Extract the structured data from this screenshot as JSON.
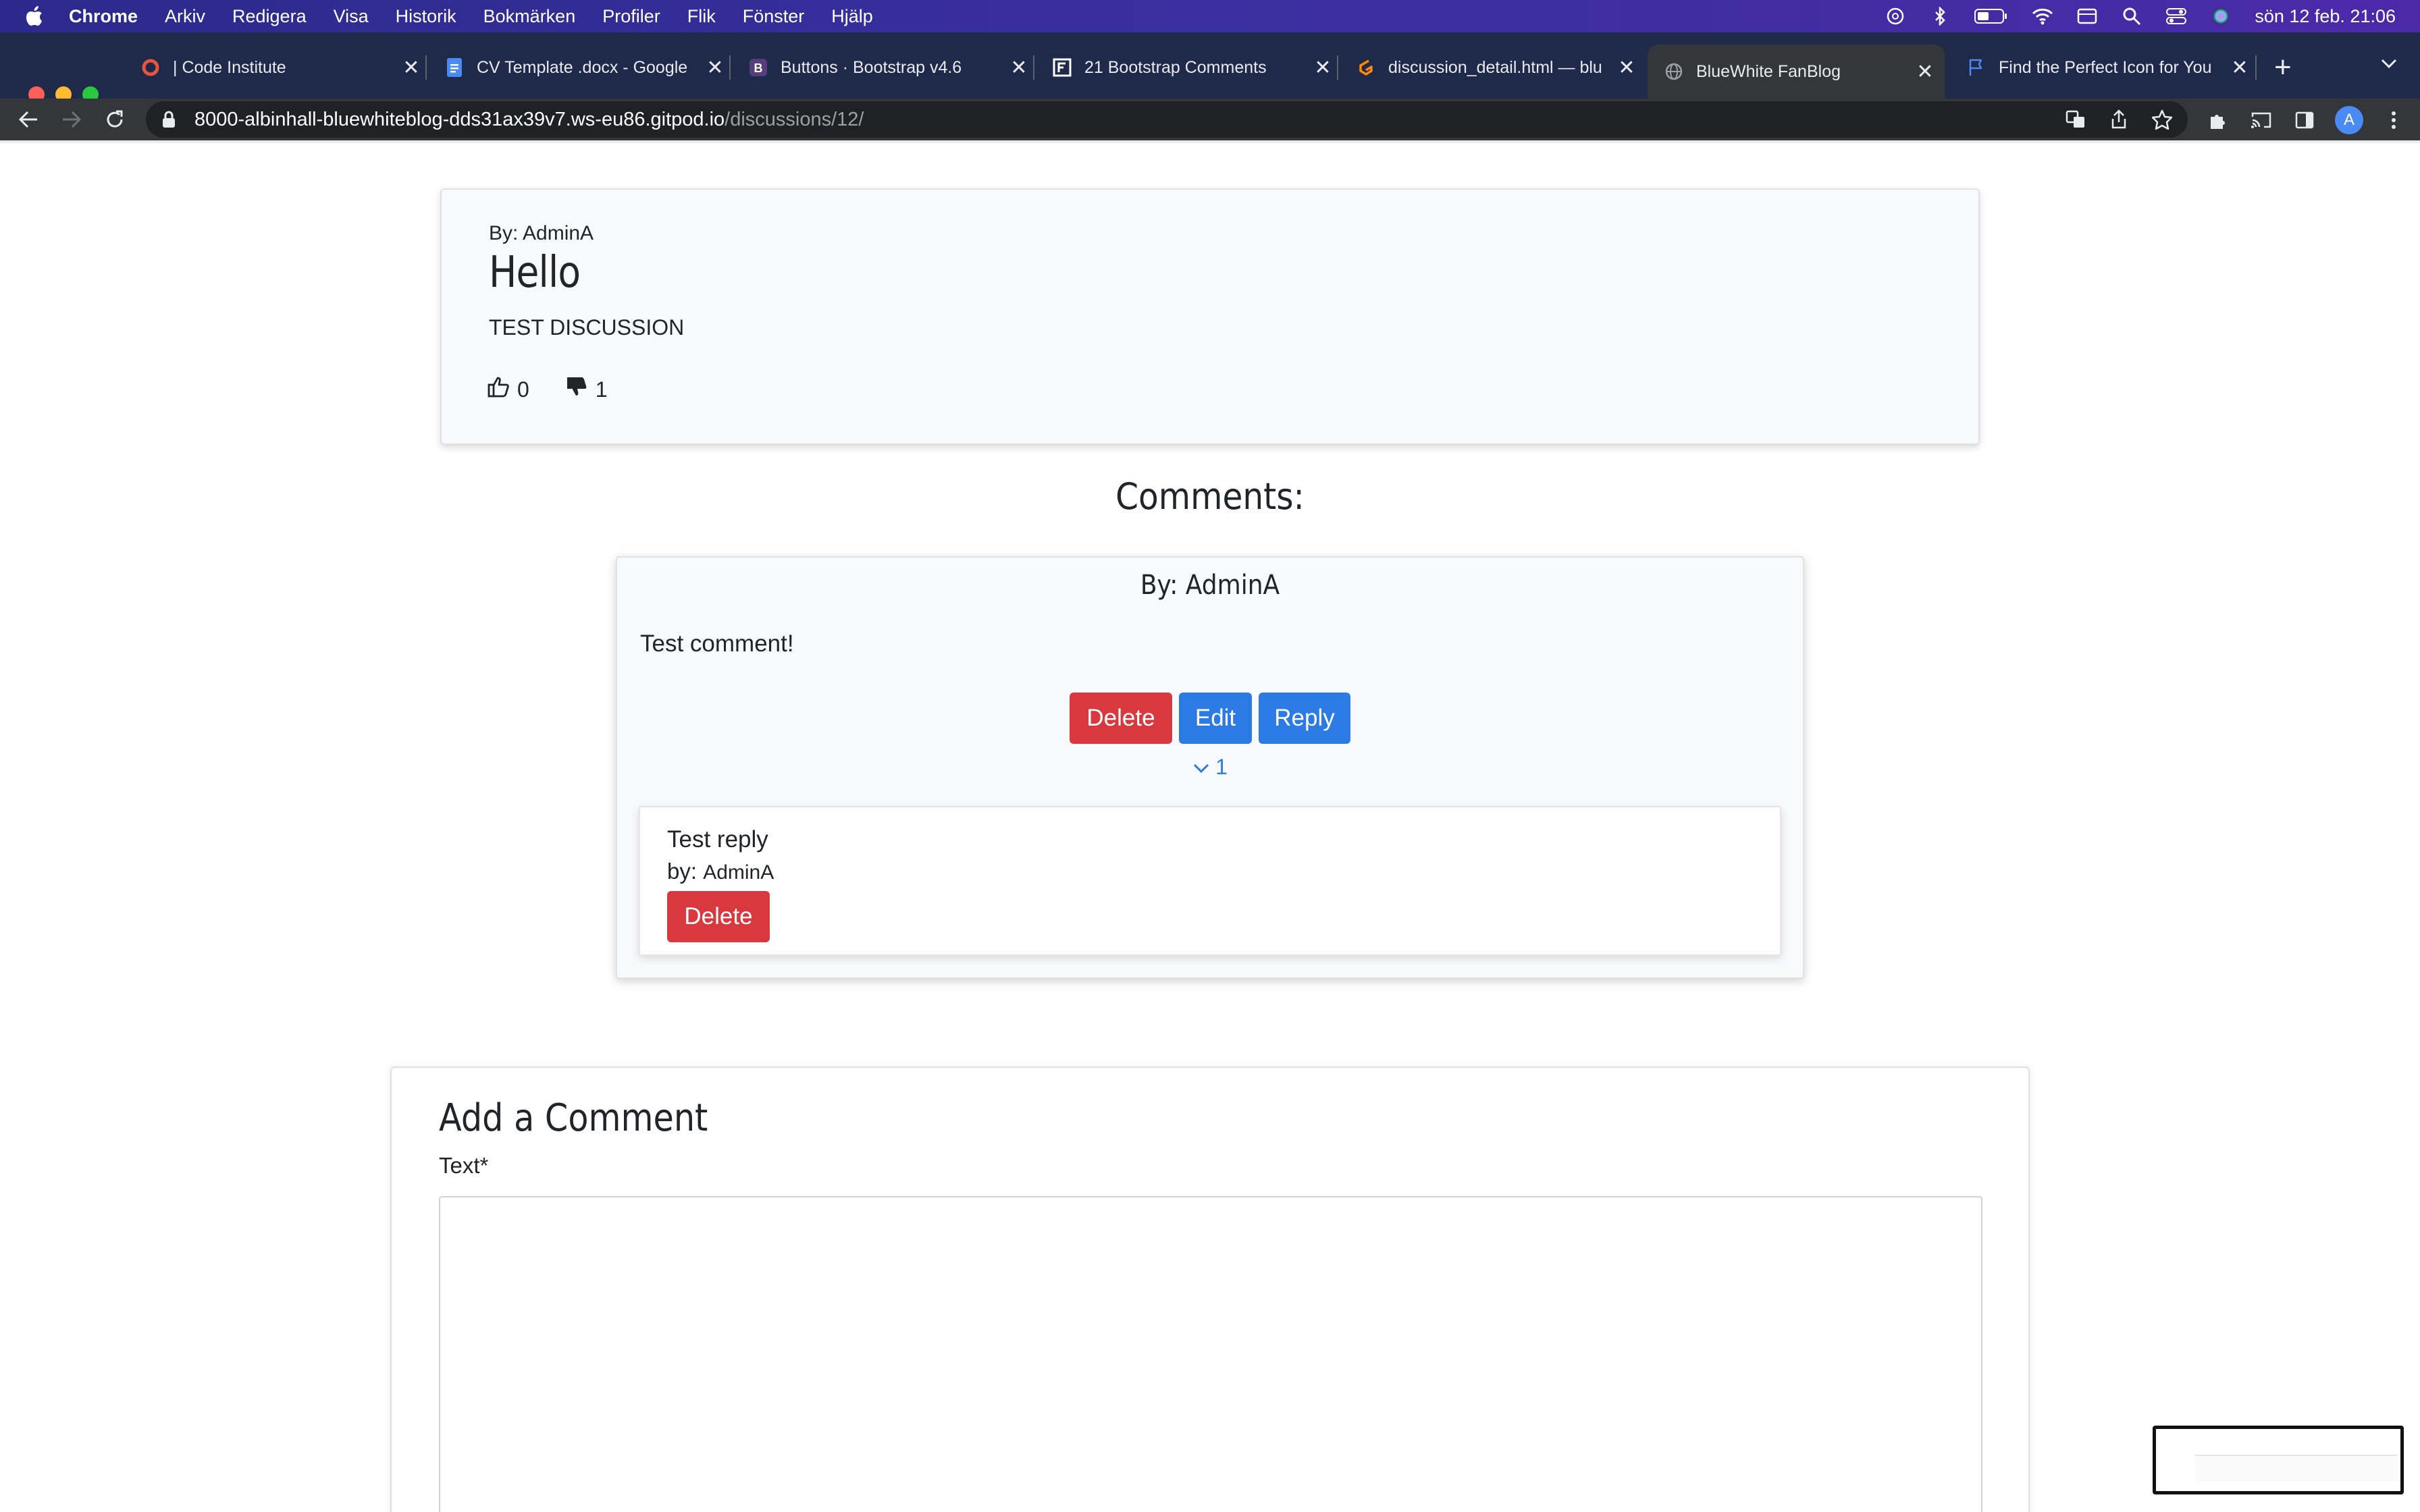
{
  "menubar": {
    "app_name": "Chrome",
    "items": [
      "Arkiv",
      "Redigera",
      "Visa",
      "Historik",
      "Bokmärken",
      "Profiler",
      "Flik",
      "Fönster",
      "Hjälp"
    ],
    "clock": "sön 12 feb.  21:06"
  },
  "tabs": [
    {
      "title": "| Code Institute",
      "icon": "code-institute-icon"
    },
    {
      "title": "CV Template .docx - Google",
      "icon": "google-docs-icon"
    },
    {
      "title": "Buttons · Bootstrap v4.6",
      "icon": "bootstrap-icon"
    },
    {
      "title": "21 Bootstrap Comments",
      "icon": "frontendor-icon"
    },
    {
      "title": "discussion_detail.html — blu",
      "icon": "gitpod-icon"
    },
    {
      "title": "BlueWhite FanBlog",
      "icon": "globe-icon",
      "active": true
    },
    {
      "title": "Find the Perfect Icon for You",
      "icon": "flag-icon"
    }
  ],
  "address_bar": {
    "host": "8000-albinhall-bluewhiteblog-dds31ax39v7.ws-eu86.gitpod.io",
    "path": "/discussions/12/"
  },
  "profile_initial": "A",
  "discussion": {
    "author": "By: AdminA",
    "title": "Hello",
    "body": "TEST DISCUSSION",
    "likes": "0",
    "dislikes": "1"
  },
  "comments_heading": "Comments:",
  "comment": {
    "author": "By: AdminA",
    "text": "Test comment!",
    "delete_label": "Delete",
    "edit_label": "Edit",
    "reply_label": "Reply",
    "reply_count": "1"
  },
  "reply": {
    "text": "Test reply",
    "by_prefix": "by:",
    "author": "AdminA",
    "delete_label": "Delete"
  },
  "form": {
    "title": "Add a Comment",
    "text_label": "Text*",
    "text_value": ""
  },
  "colors": {
    "danger": "#d9383f",
    "primary": "#2c7be5",
    "menubar": "#3a2fa0",
    "chrome_frame": "#1f2a4a"
  }
}
